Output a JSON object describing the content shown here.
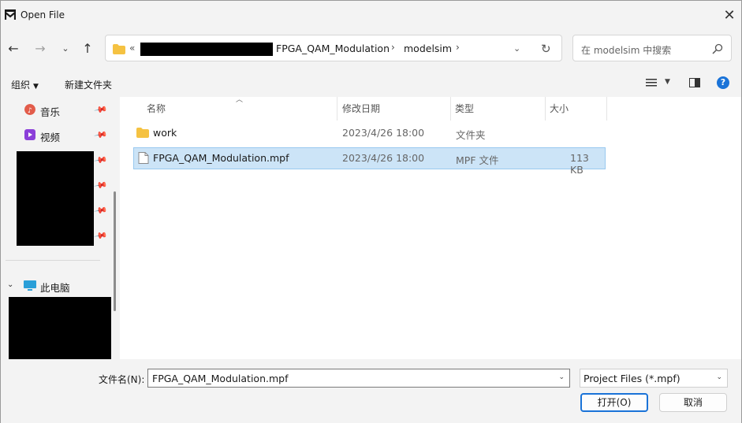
{
  "window": {
    "title": "Open File",
    "app_icon": "modelsim-logo-icon",
    "close_icon": "close-icon"
  },
  "nav": {
    "back_icon": "arrow-left-icon",
    "forward_icon": "arrow-right-icon",
    "recent_icon": "chevron-down-icon",
    "up_icon": "arrow-up-icon",
    "overflow": "«",
    "breadcrumb": [
      "FPGA_QAM_Modulation",
      "modelsim"
    ],
    "separator": "›",
    "refresh_icon": "refresh-icon",
    "search_placeholder": "在 modelsim 中搜索"
  },
  "toolbar": {
    "organize_label": "组织",
    "new_folder_label": "新建文件夹",
    "view_icon": "list-view-icon",
    "preview_icon": "preview-pane-icon",
    "help_label": "?"
  },
  "sidebar": {
    "quick_access": [
      {
        "label": "音乐",
        "icon": "music-icon",
        "color": "#e25c4a"
      },
      {
        "label": "视频",
        "icon": "video-icon",
        "color": "#8b3fd9"
      }
    ],
    "this_pc": {
      "label": "此电脑",
      "icon": "computer-icon"
    }
  },
  "columns": {
    "name": "名称",
    "modified": "修改日期",
    "type": "类型",
    "size": "大小"
  },
  "files": [
    {
      "name": "work",
      "modified": "2023/4/26 18:00",
      "type": "文件夹",
      "size": "",
      "icon": "folder-icon",
      "selected": false
    },
    {
      "name": "FPGA_QAM_Modulation.mpf",
      "modified": "2023/4/26 18:00",
      "type": "MPF 文件",
      "size": "113 KB",
      "icon": "file-icon",
      "selected": true
    }
  ],
  "footer": {
    "filename_label": "文件名(N):",
    "filename_value": "FPGA_QAM_Modulation.mpf",
    "filetype_value": "Project Files (*.mpf)",
    "open_label": "打开(O)",
    "cancel_label": "取消"
  },
  "colors": {
    "accent": "#1a73d8",
    "selection": "#cce4f7",
    "folder": "#f5c242"
  }
}
